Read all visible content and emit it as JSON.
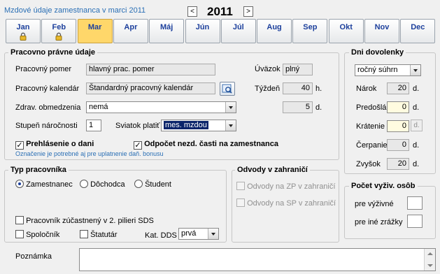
{
  "header": {
    "title": "Mzdové údaje zamestnanca v marci 2011",
    "prev": "<",
    "year": "2011",
    "next": ">"
  },
  "months": [
    {
      "label": "Jan",
      "locked": true
    },
    {
      "label": "Feb",
      "locked": true
    },
    {
      "label": "Mar",
      "active": true
    },
    {
      "label": "Apr"
    },
    {
      "label": "Máj"
    },
    {
      "label": "Jún"
    },
    {
      "label": "Júl"
    },
    {
      "label": "Aug"
    },
    {
      "label": "Sep"
    },
    {
      "label": "Okt"
    },
    {
      "label": "Nov"
    },
    {
      "label": "Dec"
    }
  ],
  "pp": {
    "title": "Pracovno právne údaje",
    "pomer_label": "Pracovný pomer",
    "pomer_value": "hlavný prac. pomer",
    "uvazok_label": "Úväzok",
    "uvazok_value": "plný",
    "kalendar_label": "Pracovný kalendár",
    "kalendar_value": "Štandardný pracovný kalendár",
    "tyzden_label": "Týždeň",
    "tyzden_value": "40",
    "tyzden_unit": "h.",
    "zdrav_label": "Zdrav. obmedzenia",
    "zdrav_value": "nemá",
    "days_value": "5",
    "days_unit": "d.",
    "narocnost_label": "Stupeň náročnosti",
    "narocnost_value": "1",
    "sviatok_label": "Sviatok platiť",
    "sviatok_value": "mes. mzdou",
    "prehlasenie_label": "Prehlásenie o dani",
    "odpocet_label": "Odpočet nezd. časti na zamestnanca",
    "hint": "Označenie je potrebné aj pre uplatnenie daň. bonusu"
  },
  "typ": {
    "title": "Typ pracovníka",
    "r1": "Zamestnanec",
    "r2": "Dôchodca",
    "r3": "Študent",
    "sds": "Pracovník zúčastnený v 2. pilieri SDS",
    "spolocnik": "Spoločník",
    "statutar": "Štatutár",
    "dds_label": "Kat. DDS",
    "dds_value": "prvá"
  },
  "odvody": {
    "title": "Odvody v zahraničí",
    "zp": "Odvody na ZP v zahraničí",
    "sp": "Odvody na SP v zahraničí"
  },
  "dov": {
    "title": "Dni dovolenky",
    "type_value": "ročný súhrn",
    "narok_label": "Nárok",
    "narok_value": "20",
    "predosla_label": "Predošlá",
    "predosla_value": "0",
    "kratenie_label": "Krátenie",
    "kratenie_value": "0",
    "cerpanie_label": "Čerpanie",
    "cerpanie_value": "0",
    "zvysok_label": "Zvyšok",
    "zvysok_value": "20",
    "unit": "d."
  },
  "pocet": {
    "title": "Počet vyživ. osôb",
    "vyzivne": "pre výživné",
    "ine": "pre iné zrážky"
  },
  "poznamka": {
    "label": "Poznámka"
  }
}
